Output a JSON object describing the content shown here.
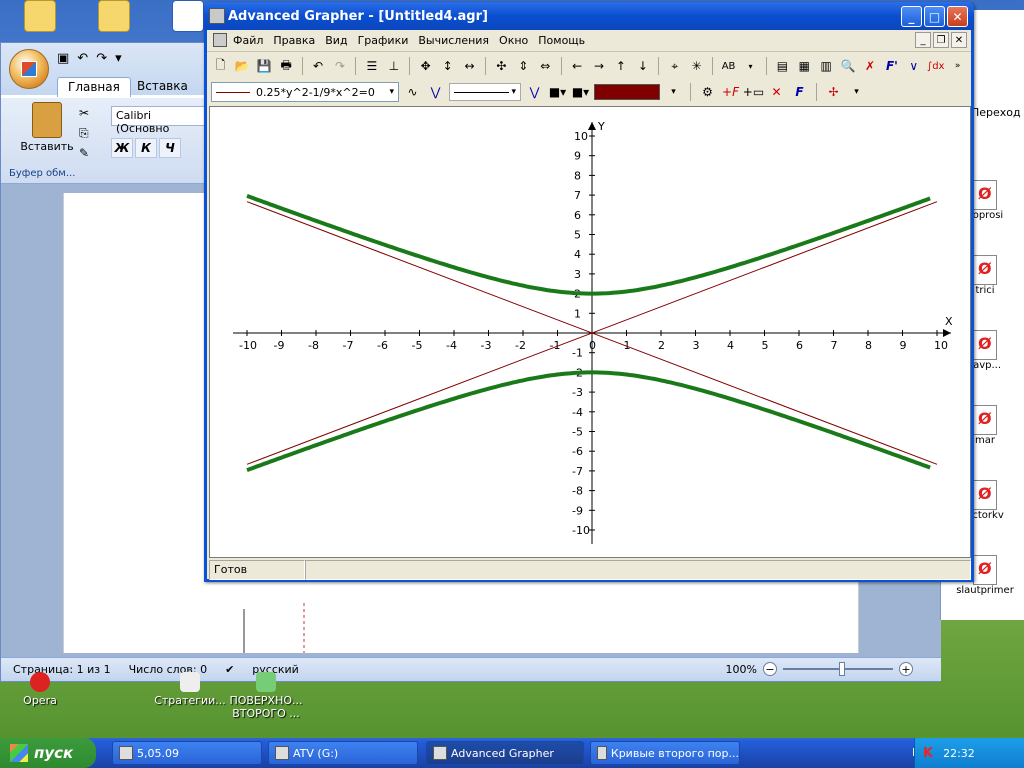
{
  "desktop": {
    "icons_top": [
      {
        "name": "folder-icon"
      },
      {
        "name": "folder-icon"
      },
      {
        "name": "word-doc-icon"
      }
    ],
    "icons_bottom": [
      {
        "label": "Opera"
      },
      {
        "label": "Стратегии..."
      },
      {
        "label": "ПОВЕРХНО... ВТОРОГО ..."
      }
    ]
  },
  "word": {
    "tabs": [
      "Главная",
      "Вставка"
    ],
    "paste_label": "Вставить",
    "clipboard_group": "Буфер обм...",
    "font_name": "Calibri (Основно",
    "format_buttons": [
      "Ж",
      "К",
      "Ч"
    ],
    "status": {
      "page": "Страница: 1 из 1",
      "words": "Число слов: 0",
      "language": "русский",
      "zoom": "100%"
    }
  },
  "explorer": {
    "header": "Переход",
    "items": [
      "voprosi",
      "trici",
      "ravp...",
      "mar",
      "ectorkv",
      "slautprimer"
    ]
  },
  "grapher": {
    "title": "Advanced Grapher - [Untitled4.agr]",
    "menu": [
      "Файл",
      "Правка",
      "Вид",
      "Графики",
      "Вычисления",
      "Окно",
      "Помощь"
    ],
    "function_expr": "0.25*y^2-1/9*x^2=0",
    "status": "Готов",
    "accent_color": "#800000",
    "curve_color": "#1a7a1a"
  },
  "chart_data": {
    "type": "line",
    "xlabel": "X",
    "ylabel": "Y",
    "xlim": [
      -10,
      10
    ],
    "ylim": [
      -10,
      10
    ],
    "xticks": [
      -10,
      -9,
      -8,
      -7,
      -6,
      -5,
      -4,
      -3,
      -2,
      -1,
      0,
      1,
      2,
      3,
      4,
      5,
      6,
      7,
      8,
      9,
      10
    ],
    "yticks": [
      -10,
      -9,
      -8,
      -7,
      -6,
      -5,
      -4,
      -3,
      -2,
      -1,
      0,
      1,
      2,
      3,
      4,
      5,
      6,
      7,
      8,
      9,
      10
    ],
    "grid": false,
    "series": [
      {
        "kind": "hyperbola",
        "color": "#1a7a1a",
        "equation": "y^2/4 - x^2/9 = 1",
        "a": 2,
        "b": 3
      },
      {
        "kind": "asymptote",
        "color": "#800000",
        "slope": 0.6667
      },
      {
        "kind": "asymptote",
        "color": "#800000",
        "slope": -0.6667
      }
    ]
  },
  "taskbar": {
    "start": "пуск",
    "tasks": [
      "5,05.09",
      "ATV (G:)",
      "Advanced Grapher",
      "Кривые второго пор..."
    ],
    "lang": "EN",
    "clock": "22:32"
  }
}
